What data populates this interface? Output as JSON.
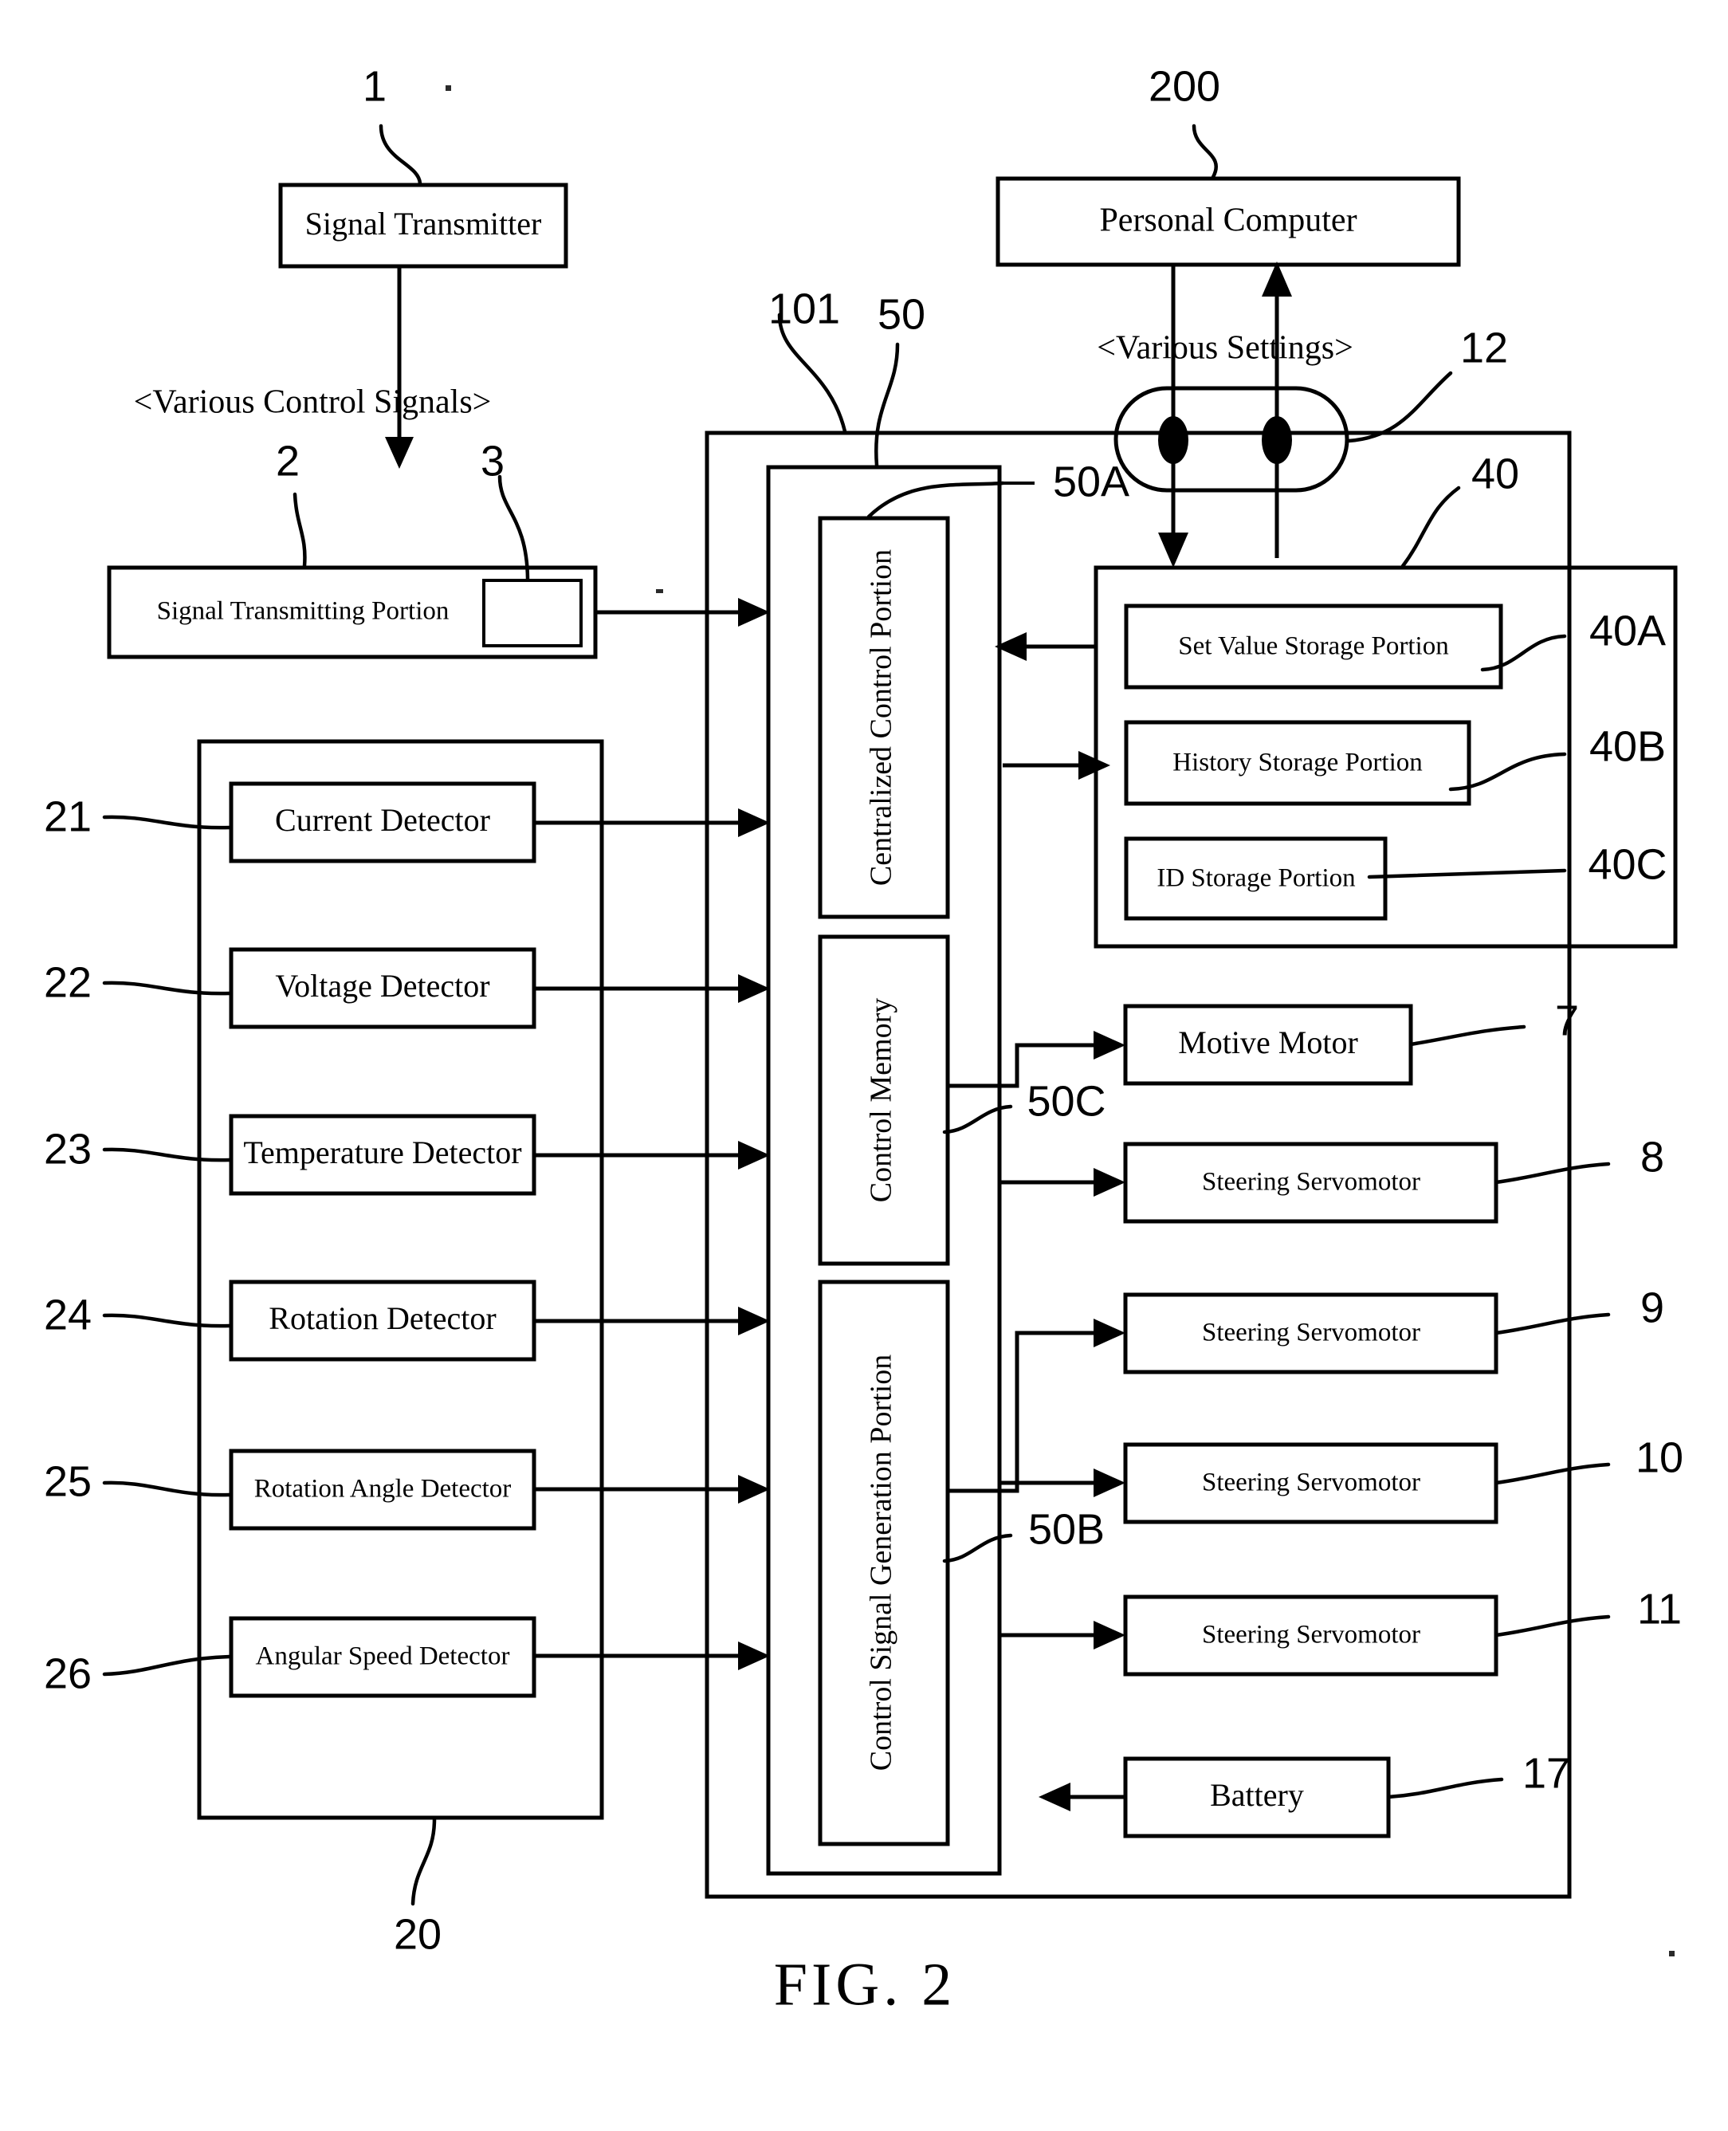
{
  "figure": {
    "caption": "FIG. 2",
    "title": "Control system block diagram"
  },
  "annotations": {
    "various_control_signals": "<Various Control Signals>",
    "various_settings": "<Various Settings>"
  },
  "blocks": {
    "signal_transmitter": {
      "label": "Signal Transmitter",
      "ref": "1"
    },
    "signal_transmitting_portion": {
      "label": "Signal Transmitting Portion",
      "ref": "2"
    },
    "signal_transmitting_inner": {
      "label": "",
      "ref": "3"
    },
    "personal_computer": {
      "label": "Personal Computer",
      "ref": "200"
    },
    "connector": {
      "label": "",
      "ref": "12"
    },
    "machine_body": {
      "label": "",
      "ref": "101"
    },
    "control_unit": {
      "label": "",
      "ref": "50"
    },
    "centralized_control_portion": {
      "label": "Centralized Control Portion",
      "ref": "50A"
    },
    "control_memory": {
      "label": "Control Memory",
      "ref": "50C"
    },
    "control_signal_generation_portion": {
      "label": "Control Signal Generation Portion",
      "ref": "50B"
    },
    "storage_unit": {
      "label": "",
      "ref": "40"
    },
    "set_value_storage_portion": {
      "label": "Set Value Storage Portion",
      "ref": "40A"
    },
    "history_storage_portion": {
      "label": "History Storage Portion",
      "ref": "40B"
    },
    "id_storage_portion": {
      "label": "ID Storage Portion",
      "ref": "40C"
    },
    "detector_group": {
      "label": "",
      "ref": "20"
    },
    "battery": {
      "label": "Battery",
      "ref": "17"
    }
  },
  "detectors": [
    {
      "label": "Current Detector",
      "ref": "21"
    },
    {
      "label": "Voltage Detector",
      "ref": "22"
    },
    {
      "label": "Temperature Detector",
      "ref": "23"
    },
    {
      "label": "Rotation Detector",
      "ref": "24"
    },
    {
      "label": "Rotation Angle Detector",
      "ref": "25"
    },
    {
      "label": "Angular Speed Detector",
      "ref": "26"
    }
  ],
  "actuators": [
    {
      "label": "Motive Motor",
      "ref": "7"
    },
    {
      "label": "Steering Servomotor",
      "ref": "8"
    },
    {
      "label": "Steering Servomotor",
      "ref": "9"
    },
    {
      "label": "Steering Servomotor",
      "ref": "10"
    },
    {
      "label": "Steering Servomotor",
      "ref": "11"
    }
  ],
  "colors": {
    "ink": "#000000",
    "paper": "#ffffff"
  }
}
